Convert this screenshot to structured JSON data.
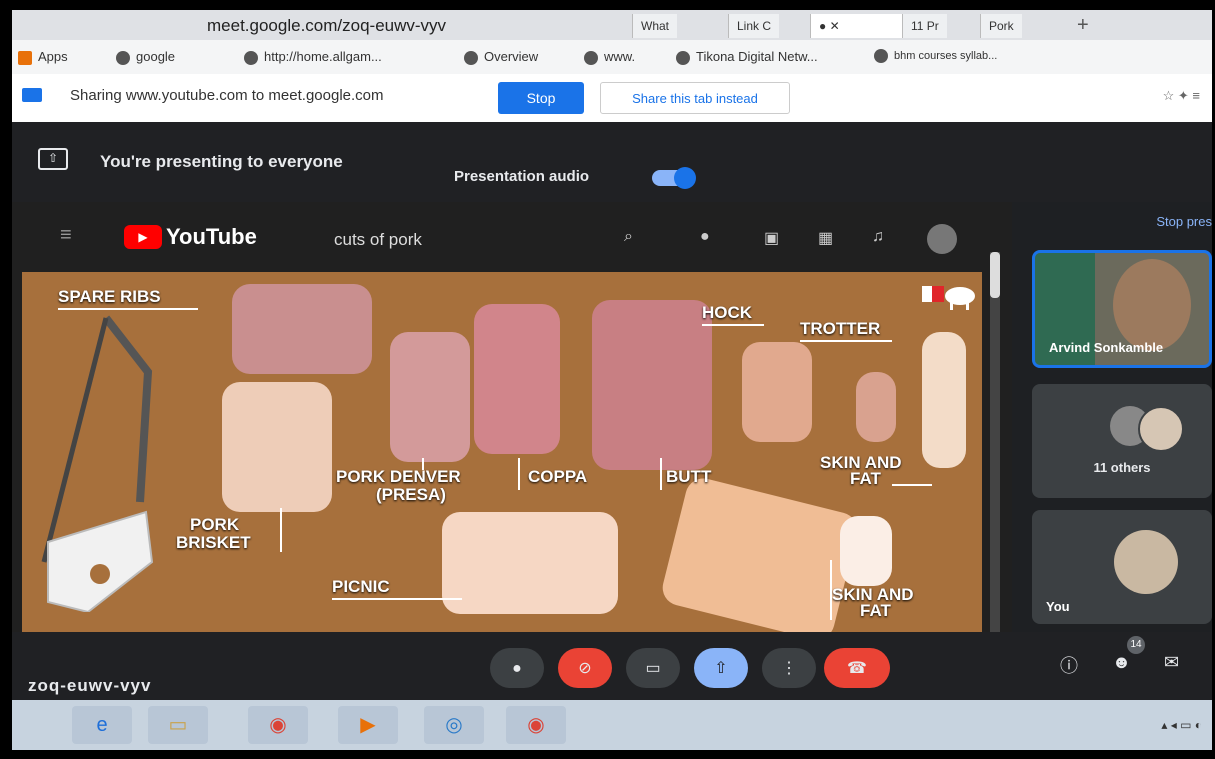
{
  "browser": {
    "address": "meet.google.com/zoq-euwv-vyv",
    "tabs": [
      "What",
      "Link C",
      "11 Pr",
      "Pork"
    ],
    "new_tab": "+",
    "bookmarks": [
      "Apps",
      "google",
      "http://home.allgam...",
      "Overview",
      "www.",
      "Tikona Digital Netw...",
      "bhm courses syllab..."
    ]
  },
  "share_bar": {
    "message": "Sharing www.youtube.com to meet.google.com",
    "stop_label": "Stop",
    "share_tab_label": "Share this tab instead"
  },
  "meet": {
    "presenting_text": "You're presenting to everyone",
    "audio_label": "Presentation audio",
    "audio_on": true,
    "stop_presenting": "Stop pres",
    "meeting_code": "zoq-euwv-vyv",
    "participant_count": "14",
    "tiles": {
      "main_name": "Arvind Sonkamble",
      "others": "11 others",
      "self": "You"
    }
  },
  "youtube": {
    "logo": "YouTube",
    "search_value": "cuts of pork"
  },
  "video_labels": {
    "spare_ribs": "SPARE RIBS",
    "hock": "HOCK",
    "trotter": "TROTTER",
    "pork_denver": "PORK DENVER",
    "presa": "(PRESA)",
    "coppa": "COPPA",
    "butt": "BUTT",
    "skin_fat_1a": "SKIN AND",
    "skin_fat_1b": "FAT",
    "pork_brisket_a": "PORK",
    "pork_brisket_b": "BRISKET",
    "picnic": "PICNIC",
    "skin_fat_2a": "SKIN AND",
    "skin_fat_2b": "FAT"
  },
  "colors": {
    "meet_bg": "#202124",
    "accent_blue": "#1a73e8",
    "end_call_red": "#ea4335",
    "youtube_red": "#ff0000"
  }
}
